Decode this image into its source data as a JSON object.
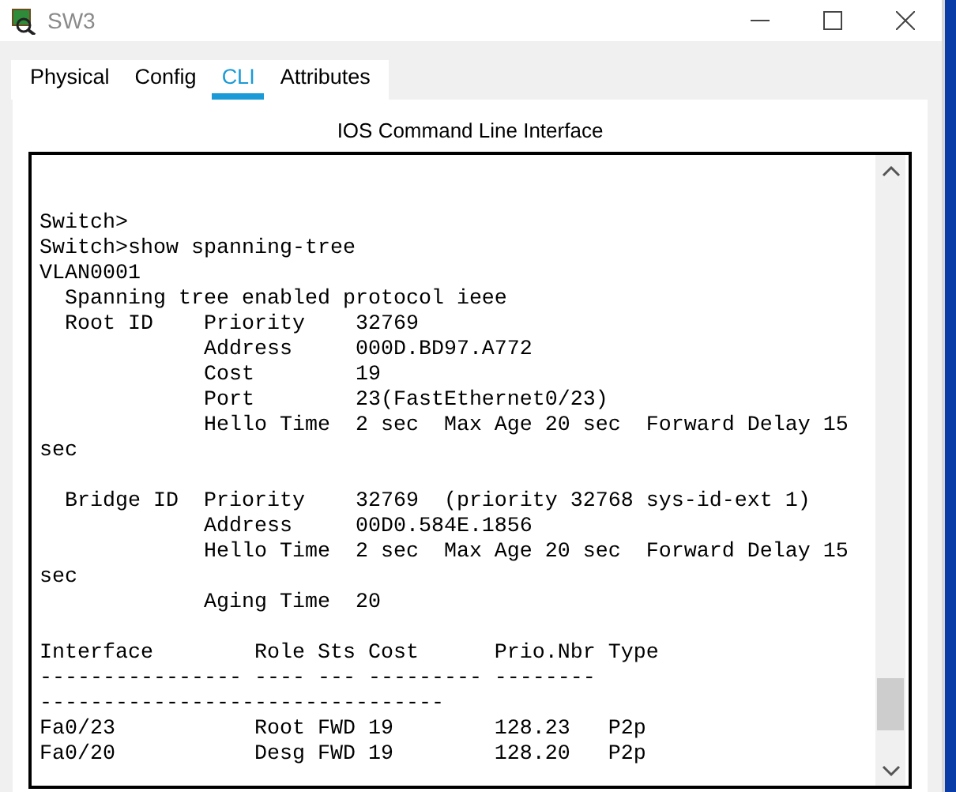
{
  "window": {
    "title": "SW3"
  },
  "tabs": [
    {
      "label": "Physical",
      "selected": false
    },
    {
      "label": "Config",
      "selected": false
    },
    {
      "label": "CLI",
      "selected": true
    },
    {
      "label": "Attributes",
      "selected": false
    }
  ],
  "panel": {
    "title": "IOS Command Line Interface"
  },
  "terminal": {
    "lines": [
      {
        "kind": "blank"
      },
      {
        "kind": "blank"
      },
      {
        "kind": "text",
        "text": "Switch>"
      },
      {
        "kind": "text",
        "text": "Switch>show spanning-tree"
      },
      {
        "kind": "text",
        "text": "VLAN0001"
      },
      {
        "kind": "text",
        "text": "  Spanning tree enabled protocol ieee"
      },
      {
        "kind": "text",
        "text": "  Root ID    Priority    32769"
      },
      {
        "kind": "text",
        "text": "             Address     000D.BD97.A772"
      },
      {
        "kind": "text",
        "text": "             Cost        19"
      },
      {
        "kind": "text",
        "text": "             Port        23(FastEthernet0/23)"
      },
      {
        "kind": "text",
        "text": "             Hello Time  2 sec  Max Age 20 sec  Forward Delay 15"
      },
      {
        "kind": "text",
        "text": "sec"
      },
      {
        "kind": "blank"
      },
      {
        "kind": "text",
        "text": "  Bridge ID  Priority    32769  (priority 32768 sys-id-ext 1)"
      },
      {
        "kind": "text",
        "text": "             Address     00D0.584E.1856"
      },
      {
        "kind": "text",
        "text": "             Hello Time  2 sec  Max Age 20 sec  Forward Delay 15"
      },
      {
        "kind": "text",
        "text": "sec"
      },
      {
        "kind": "text",
        "text": "             Aging Time  20"
      },
      {
        "kind": "blank"
      },
      {
        "kind": "text",
        "text": "Interface        Role Sts Cost      Prio.Nbr Type"
      },
      {
        "kind": "text",
        "text": "---------------- ---- --- --------- --------"
      },
      {
        "kind": "text",
        "text": "--------------------------------"
      },
      {
        "kind": "text",
        "text": "Fa0/23           Root FWD 19        128.23   P2p"
      },
      {
        "kind": "text",
        "text": "Fa0/20           Desg FWD 19        128.20   P2p"
      }
    ]
  }
}
